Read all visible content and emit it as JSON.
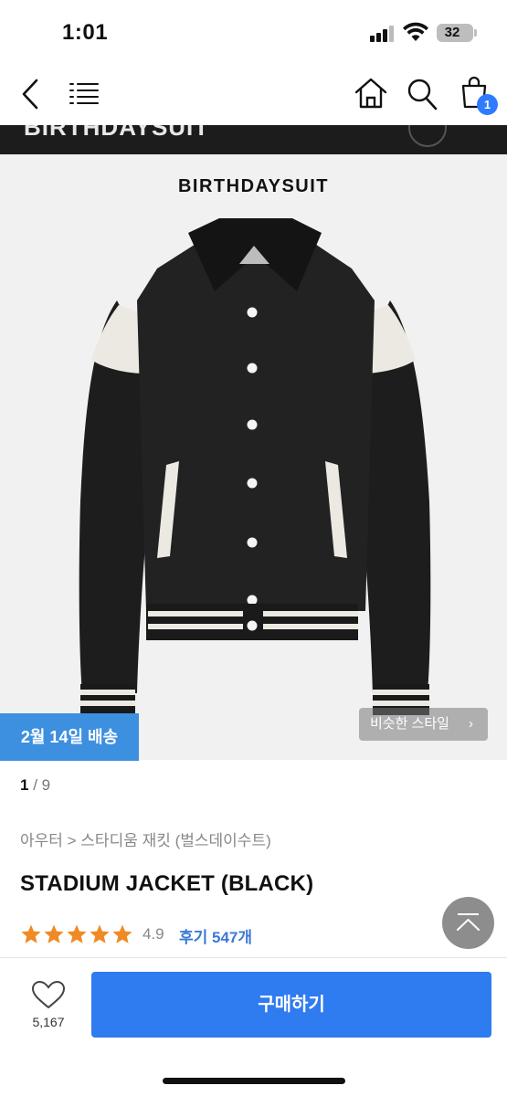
{
  "status": {
    "time": "1:01",
    "battery": "32"
  },
  "nav": {
    "cart_count": "1"
  },
  "strip": {
    "text": "BIRTHDAYSUIT"
  },
  "product": {
    "brand_logo": "BIRTHDAYSUIT",
    "delivery": "2월 14일 배송",
    "similar_style": "비슷한 스타일",
    "page_current": "1",
    "page_total": " / 9",
    "breadcrumb": "아우터 > 스타디움 재킷 (벌스데이수트)",
    "title": "STADIUM JACKET (BLACK)",
    "rating": "4.9",
    "reviews": "후기 547개",
    "rating_stars": 5
  },
  "bottom": {
    "like_count": "5,167",
    "buy_label": "구매하기"
  },
  "colors": {
    "accent": "#2f7bf0",
    "badge": "#3d8fe0",
    "star": "#f08a24",
    "review_link": "#3b79d6"
  },
  "icons": [
    "back-icon",
    "menu-icon",
    "home-icon",
    "search-icon",
    "cart-icon",
    "heart-icon",
    "scroll-top-icon",
    "chevron-right-icon",
    "star-icon"
  ]
}
